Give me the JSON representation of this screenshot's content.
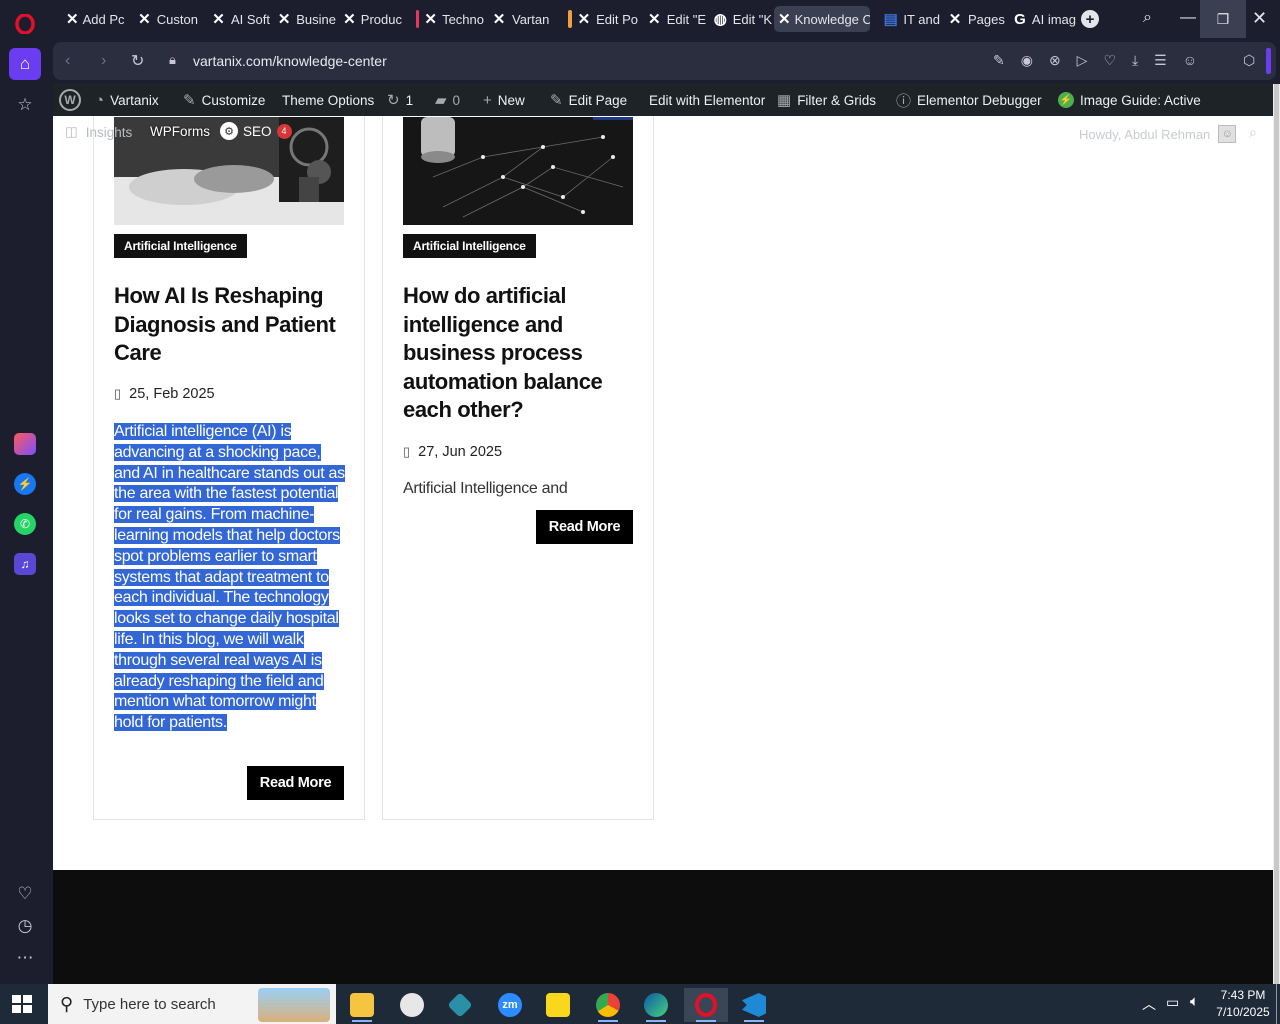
{
  "browser": {
    "tabs": [
      {
        "label": "Add Pc"
      },
      {
        "label": "Custon"
      },
      {
        "label": "AI Soft"
      },
      {
        "label": "Busine"
      },
      {
        "label": "Produc"
      },
      {
        "label": "Techno"
      },
      {
        "label": "Vartan"
      },
      {
        "label": "Edit Po"
      },
      {
        "label": "Edit \"E"
      },
      {
        "label": "Edit \"K"
      },
      {
        "label": "Knowledge C"
      },
      {
        "label": "IT and"
      },
      {
        "label": "Pages"
      },
      {
        "label": "AI imag"
      }
    ],
    "url": "vartanix.com/knowledge-center"
  },
  "wp_admin_bar": {
    "site_name": "Vartanix",
    "customize": "Customize",
    "theme_options": "Theme Options",
    "updates_count": "1",
    "comments_count": "0",
    "new": "New",
    "edit_page": "Edit Page",
    "edit_elementor": "Edit with Elementor",
    "filter_grids": "Filter & Grids",
    "elementor_debugger": "Elementor Debugger",
    "image_guide": "Image Guide: Active",
    "insights": "Insights",
    "wpforms": "WPForms",
    "seo": "SEO",
    "seo_count": "4",
    "howdy": "Howdy, Abdul Rehman"
  },
  "posts": [
    {
      "category": "Artificial Intelligence",
      "title": "How AI Is Reshaping Diagnosis and Patient Care",
      "date": "25, Feb 2025",
      "excerpt": "Artificial intelligence (AI) is advancing at a shocking pace, and AI in healthcare stands out as the area with the fastest potential for real gains. From machine-learning models that help doctors spot problems earlier to smart systems that adapt treatment to each individual. The technology looks set to change daily hospital life. In this blog, we will walk through several real ways AI is already reshaping the field and mention what tomorrow might hold for patients.",
      "read_more": "Read More"
    },
    {
      "category": "Artificial Intelligence",
      "title": "How do artificial intelligence and business process automation balance each other?",
      "date": "27, Jun 2025",
      "excerpt": "Artificial Intelligence and",
      "read_more": "Read More"
    }
  ],
  "taskbar": {
    "search_placeholder": "Type here to search",
    "time": "7:43 PM",
    "date": "7/10/2025"
  },
  "colors": {
    "selection": "#3367d6",
    "opera_red": "#e3102a",
    "wp_bar": "#1d2327"
  }
}
